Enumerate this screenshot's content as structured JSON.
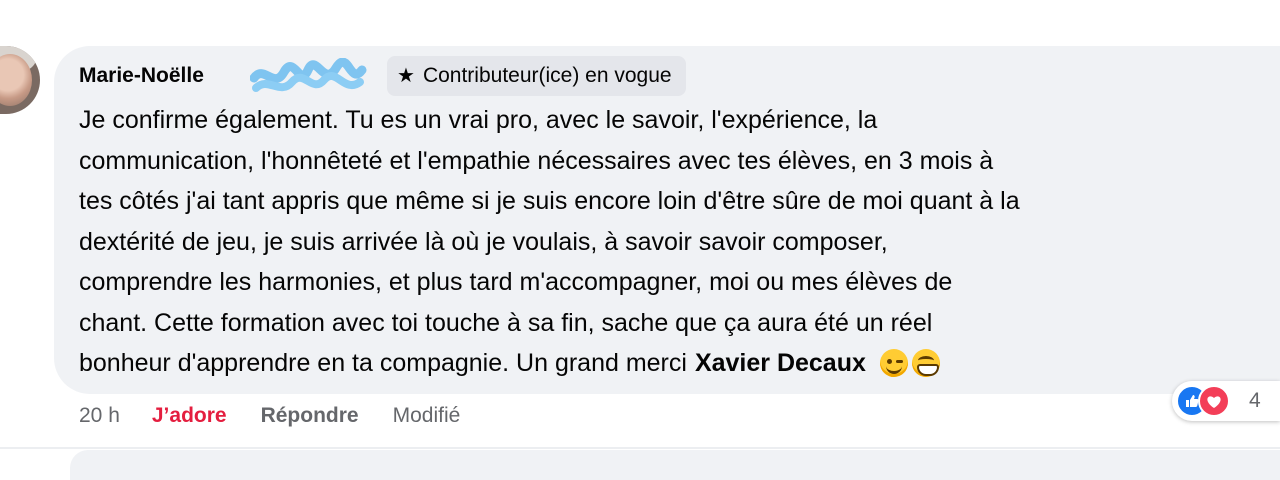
{
  "comment": {
    "author": "Marie-Noëlle",
    "badge": "Contributeur(ice) en vogue",
    "badge_icon": "star-icon",
    "body_lines": [
      "Je confirme également. Tu es un vrai pro, avec le savoir, l'expérience, la",
      "communication, l'honnêteté et l'empathie nécessaires avec tes élèves, en 3 mois à",
      "tes côtés j'ai tant appris que même si je suis encore loin d'être sûre de moi quant à la",
      "dextérité de jeu, je suis arrivée là où je voulais, à savoir savoir composer,",
      "comprendre les harmonies, et plus tard m'accompagner, moi ou mes élèves de",
      "chant. Cette formation avec toi touche à sa fin, sache que ça aura été un réel",
      "bonheur d'apprendre en ta compagnie. Un grand merci"
    ],
    "mention": "Xavier Decaux",
    "emojis": [
      "winking-face-emoji",
      "grinning-face-emoji"
    ]
  },
  "meta": {
    "time": "20 h",
    "reaction": "J’adore",
    "reply": "Répondre",
    "edited": "Modifié"
  },
  "reactions": {
    "icons": [
      "like-icon",
      "love-icon"
    ],
    "count": "4"
  },
  "colors": {
    "bubble": "#f0f2f5",
    "badge": "#e4e6eb",
    "love_text": "#e41e3f",
    "secondary_text": "#65676b",
    "like": "#1877f2",
    "love": "#f33e58",
    "redaction": "#7fc4f0"
  }
}
